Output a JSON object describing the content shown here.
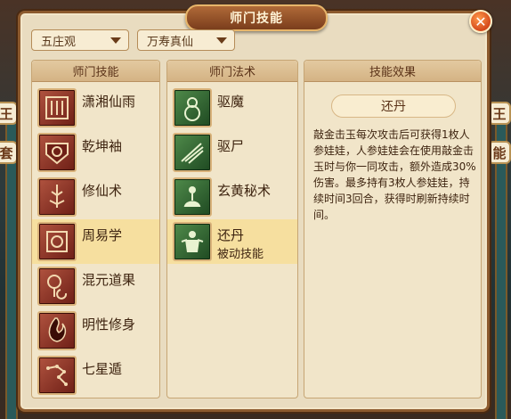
{
  "window": {
    "title": "师门技能",
    "close_label": "✕"
  },
  "filters": {
    "school": "五庄观",
    "master": "万寿真仙"
  },
  "panels": {
    "skills_header": "师门技能",
    "spells_header": "师门法术",
    "effect_header": "技能效果"
  },
  "skills": [
    {
      "label": "潇湘仙雨",
      "icon": "rain-icon"
    },
    {
      "label": "乾坤袖",
      "icon": "sleeve-icon"
    },
    {
      "label": "修仙术",
      "icon": "sword-icon"
    },
    {
      "label": "周易学",
      "icon": "bagua-icon"
    },
    {
      "label": "混元道果",
      "icon": "fruit-icon"
    },
    {
      "label": "明性修身",
      "icon": "flame-icon"
    },
    {
      "label": "七星遁",
      "icon": "constellation-icon"
    }
  ],
  "spells": [
    {
      "label": "驱魔",
      "sub": "",
      "icon": "gourd-icon"
    },
    {
      "label": "驱尸",
      "sub": "",
      "icon": "whip-icon"
    },
    {
      "label": "玄黄秘术",
      "sub": "",
      "icon": "meditation-icon"
    },
    {
      "label": "还丹",
      "sub": "被动技能",
      "icon": "elixir-figure-icon"
    }
  ],
  "effect": {
    "name": "还丹",
    "description": "敲金击玉每次攻击后可获得1枚人参娃娃，人参娃娃会在使用敲金击玉时与你一同攻击，额外造成30%伤害。最多持有3枚人参娃娃，持续时间3回合，获得时刷新持续时间。"
  },
  "background_signs": [
    "王",
    "能",
    "王",
    "套"
  ]
}
